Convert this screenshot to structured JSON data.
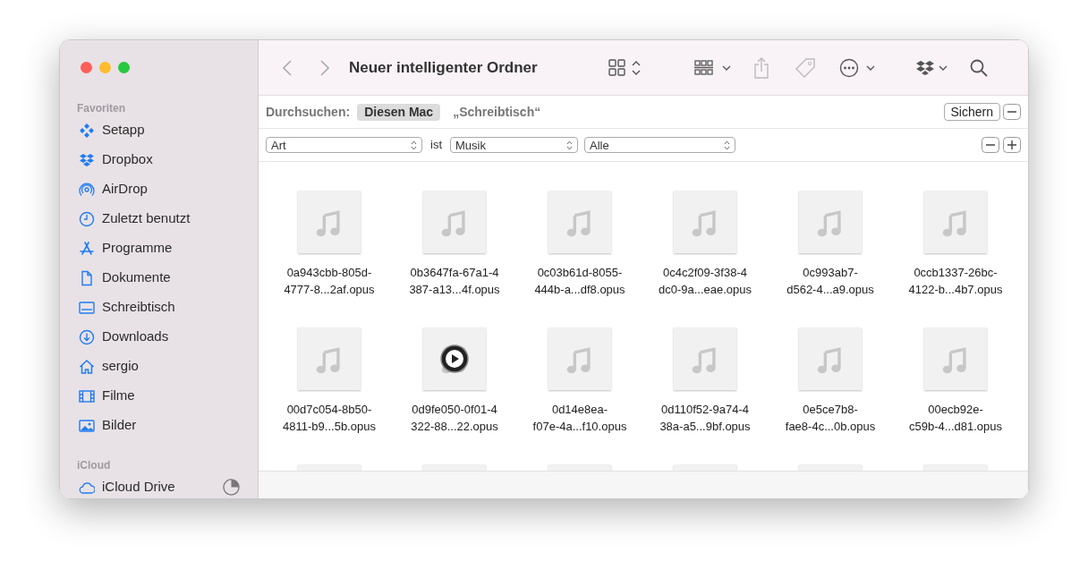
{
  "window": {
    "title": "Neuer intelligenter Ordner"
  },
  "sidebar": {
    "sections": [
      {
        "heading": "Favoriten",
        "items": [
          {
            "label": "Setapp"
          },
          {
            "label": "Dropbox"
          },
          {
            "label": "AirDrop"
          },
          {
            "label": "Zuletzt benutzt"
          },
          {
            "label": "Programme"
          },
          {
            "label": "Dokumente"
          },
          {
            "label": "Schreibtisch"
          },
          {
            "label": "Downloads"
          },
          {
            "label": "sergio"
          },
          {
            "label": "Filme"
          },
          {
            "label": "Bilder"
          }
        ]
      },
      {
        "heading": "iCloud",
        "items": [
          {
            "label": "iCloud Drive"
          }
        ]
      }
    ]
  },
  "search_scope": {
    "label": "Durchsuchen:",
    "scopes": [
      {
        "label": "Diesen Mac",
        "selected": true
      },
      {
        "label": "„Schreibtisch“",
        "selected": false
      }
    ],
    "save_button": "Sichern"
  },
  "criteria": {
    "attribute": "Art",
    "operator": "ist",
    "value": "Musik",
    "qualifier": "Alle"
  },
  "files": [
    {
      "kind": "file",
      "line1": "0a943cbb-805d-",
      "line2": "4777-8...2af.opus",
      "playing": false
    },
    {
      "kind": "file",
      "line1": "0b3647fa-67a1-4",
      "line2": "387-a13...4f.opus",
      "playing": false
    },
    {
      "kind": "file",
      "line1": "0c03b61d-8055-",
      "line2": "444b-a...df8.opus",
      "playing": false
    },
    {
      "kind": "file",
      "line1": "0c4c2f09-3f38-4",
      "line2": "dc0-9a...eae.opus",
      "playing": false
    },
    {
      "kind": "file",
      "line1": "0c993ab7-",
      "line2": "d562-4...a9.opus",
      "playing": false
    },
    {
      "kind": "file",
      "line1": "0ccb1337-26bc-",
      "line2": "4122-b...4b7.opus",
      "playing": false
    },
    {
      "kind": "file",
      "line1": "00d7c054-8b50-",
      "line2": "4811-b9...5b.opus",
      "playing": false
    },
    {
      "kind": "file",
      "line1": "0d9fe050-0f01-4",
      "line2": "322-88...22.opus",
      "playing": true
    },
    {
      "kind": "file",
      "line1": "0d14e8ea-",
      "line2": "f07e-4a...f10.opus",
      "playing": false
    },
    {
      "kind": "file",
      "line1": "0d110f52-9a74-4",
      "line2": "38a-a5...9bf.opus",
      "playing": false
    },
    {
      "kind": "file",
      "line1": "0e5ce7b8-",
      "line2": "fae8-4c...0b.opus",
      "playing": false
    },
    {
      "kind": "file",
      "line1": "00ecb92e-",
      "line2": "c59b-4...d81.opus",
      "playing": false
    },
    {
      "kind": "partial"
    },
    {
      "kind": "partial"
    },
    {
      "kind": "partial"
    },
    {
      "kind": "partial"
    },
    {
      "kind": "partial"
    },
    {
      "kind": "partial"
    }
  ]
}
